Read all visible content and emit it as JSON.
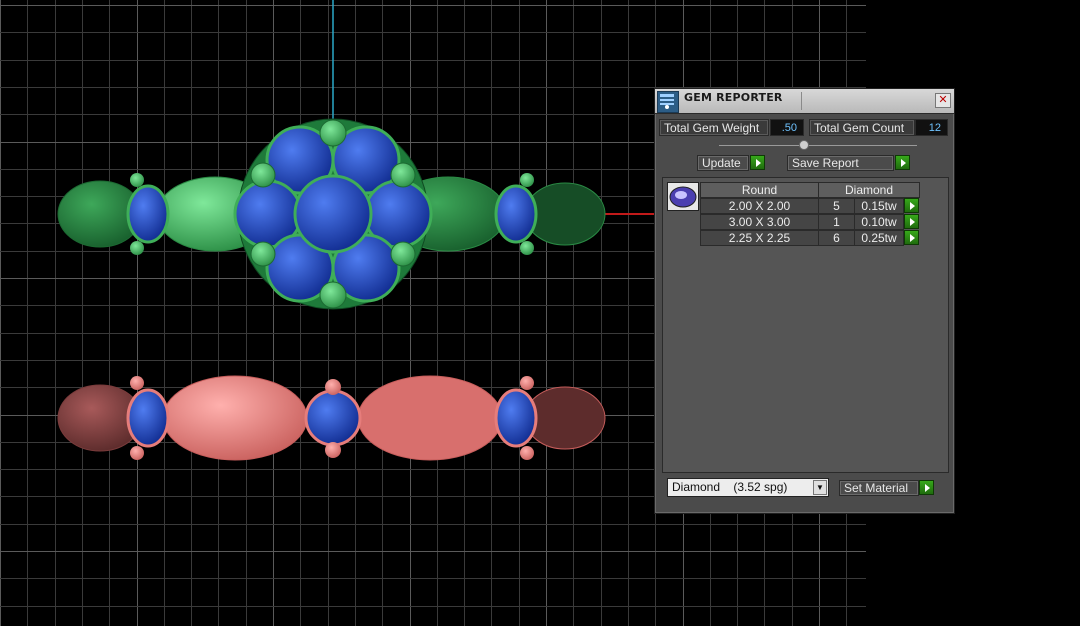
{
  "panel": {
    "title": "GEM REPORTER",
    "total_weight_label": "Total Gem Weight",
    "total_weight_value": ".50",
    "total_count_label": "Total Gem Count",
    "total_count_value": "12",
    "update_label": "Update",
    "save_label": "Save Report",
    "table": {
      "headers": [
        "Round",
        "Diamond"
      ],
      "rows": [
        {
          "size": "2.00 X 2.00",
          "count": "5",
          "weight": "0.15tw"
        },
        {
          "size": "3.00 X 3.00",
          "count": "1",
          "weight": "0.10tw"
        },
        {
          "size": "2.25 X 2.25",
          "count": "6",
          "weight": "0.25tw"
        }
      ]
    },
    "material_value": "Diamond    (3.52 spg)",
    "set_material_label": "Set Material"
  },
  "icons": [
    "gem-reporter-icon",
    "close-icon",
    "round-gem-icon",
    "dropdown-arrow-icon",
    "play-arrow-icon"
  ],
  "colors": {
    "green_ring": "#3fae58",
    "pink_ring": "#e67d7b",
    "sapphire": "#1b3fb8",
    "axis_cyan": "#2aa7c7",
    "axis_red": "#c21a1a",
    "field_value": "#6fc3ff",
    "button_green": "#2c8f16"
  }
}
